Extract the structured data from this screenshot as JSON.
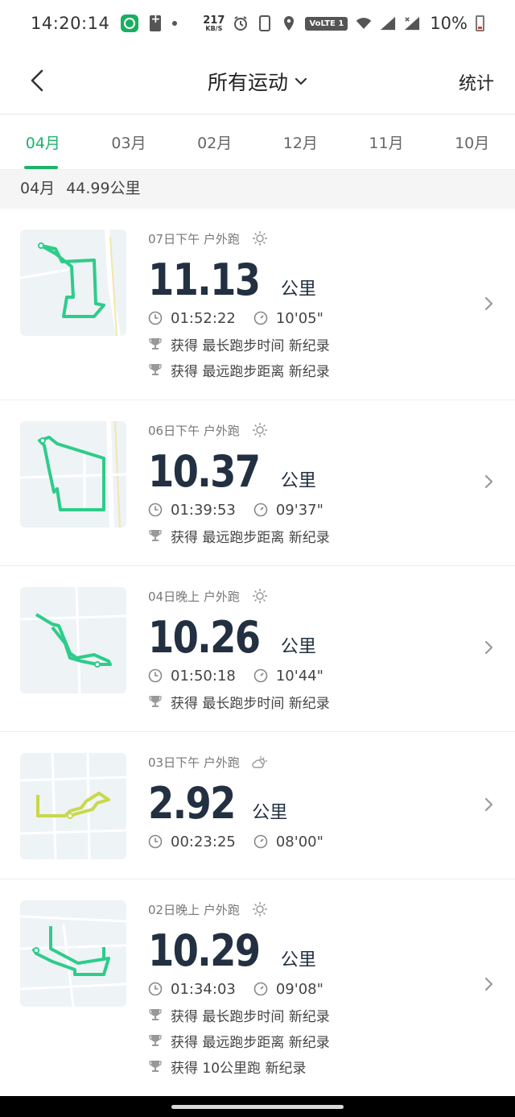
{
  "status_bar": {
    "time": "14:20:14",
    "speed_value": "217",
    "speed_unit": "KB/S",
    "volte": "VoLTE 1",
    "battery": "10%"
  },
  "header": {
    "title": "所有运动",
    "stats": "统计"
  },
  "tabs": [
    "04月",
    "03月",
    "02月",
    "12月",
    "11月",
    "10月"
  ],
  "summary": {
    "month": "04月",
    "total": "44.99公里"
  },
  "runs": [
    {
      "meta": "07日下午 户外跑",
      "weather_icon": "sun-icon",
      "distance": "11.13",
      "unit": "公里",
      "duration": "01:52:22",
      "pace": "10'05\"",
      "route_color": "#2ecc8a",
      "records": [
        "获得 最长跑步时间 新纪录",
        "获得 最远跑步距离 新纪录"
      ]
    },
    {
      "meta": "06日下午 户外跑",
      "weather_icon": "sun-icon",
      "distance": "10.37",
      "unit": "公里",
      "duration": "01:39:53",
      "pace": "09'37\"",
      "route_color": "#2ecc8a",
      "records": [
        "获得 最远跑步距离 新纪录"
      ]
    },
    {
      "meta": "04日晚上 户外跑",
      "weather_icon": "sun-icon",
      "distance": "10.26",
      "unit": "公里",
      "duration": "01:50:18",
      "pace": "10'44\"",
      "route_color": "#2ecc8a",
      "records": [
        "获得 最长跑步时间 新纪录"
      ]
    },
    {
      "meta": "03日下午 户外跑",
      "weather_icon": "partly-cloudy-icon",
      "distance": "2.92",
      "unit": "公里",
      "duration": "00:23:25",
      "pace": "08'00\"",
      "route_color": "#c9d84a",
      "records": []
    },
    {
      "meta": "02日晚上 户外跑",
      "weather_icon": "sun-icon",
      "distance": "10.29",
      "unit": "公里",
      "duration": "01:34:03",
      "pace": "09'08\"",
      "route_color": "#2ecc8a",
      "records": [
        "获得 最长跑步时间 新纪录",
        "获得 最远跑步距离 新纪录",
        "获得 10公里跑 新纪录"
      ]
    }
  ],
  "colors": {
    "accent": "#1fb36b",
    "distance_text": "#223041"
  }
}
